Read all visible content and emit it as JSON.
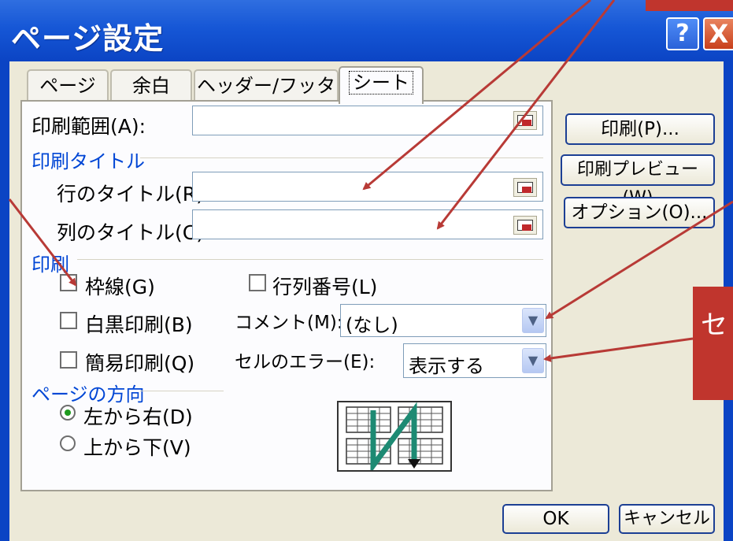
{
  "window": {
    "title": "ページ設定",
    "help_label": "?",
    "close_label": "X"
  },
  "tabs": [
    {
      "label": "ページ"
    },
    {
      "label": "余白"
    },
    {
      "label": "ヘッダー/フッター"
    },
    {
      "label": "シート"
    }
  ],
  "print_area": {
    "label": "印刷範囲(A):",
    "value": ""
  },
  "print_titles": {
    "group_label": "印刷タイトル",
    "rows_label": "行のタイトル(R):",
    "rows_value": "",
    "cols_label": "列のタイトル(C):",
    "cols_value": ""
  },
  "print": {
    "group_label": "印刷",
    "gridlines": {
      "label": "枠線(G)",
      "checked": false
    },
    "headings": {
      "label": "行列番号(L)",
      "checked": false
    },
    "black_white": {
      "label": "白黒印刷(B)",
      "checked": false
    },
    "draft": {
      "label": "簡易印刷(Q)",
      "checked": false
    },
    "comments_label": "コメント(M):",
    "comments_value": "(なし)",
    "errors_label": "セルのエラー(E):",
    "errors_value": "表示する"
  },
  "page_order": {
    "group_label": "ページの方向",
    "down_then_over": "左から右(D)",
    "over_then_down": "上から下(V)",
    "selected": "左から右(D)"
  },
  "side_buttons": {
    "print": "印刷(P)...",
    "preview": "印刷プレビュー(W)",
    "options": "オプション(O)..."
  },
  "footer": {
    "ok": "OK",
    "cancel": "キャンセル"
  },
  "callout": {
    "text": "セ"
  },
  "colors": {
    "titlebar": "#1657d6",
    "dialog_bg": "#ece9d8",
    "group_title": "#0046d5",
    "annotation": "#c0352d"
  },
  "icons": [
    "collapse-dialog-icon",
    "dropdown-arrow-icon",
    "page-order-preview-icon"
  ]
}
